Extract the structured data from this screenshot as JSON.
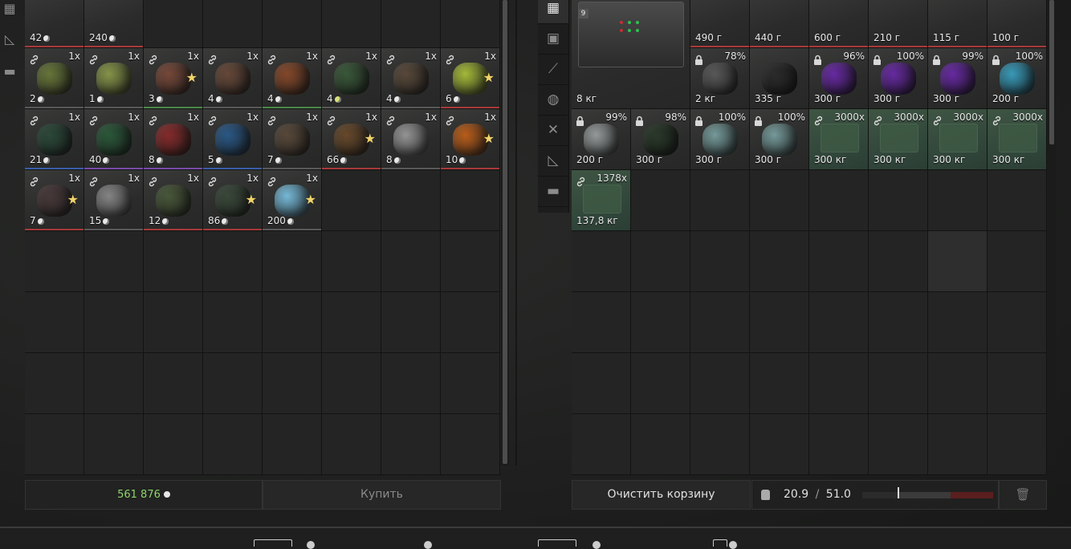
{
  "colors": {
    "accent_money": "#8fd46a",
    "rarity_red": "#a83a3a",
    "rarity_green": "#4a8a4a",
    "rarity_blue": "#3a5ea8",
    "rarity_purple": "#7a4aa8",
    "rarity_yellow": "#b8a03a",
    "rarity_grey": "#5a5a5a"
  },
  "left_sidebar": {
    "icons": [
      "grid-icon",
      "ruler-icon",
      "archive-icon"
    ]
  },
  "left_inventory": {
    "top_row": [
      {
        "val": "42",
        "rarity": "#a83a3a"
      },
      {
        "val": "240",
        "rarity": "#a83a3a"
      }
    ],
    "rows": [
      [
        {
          "qty": "1x",
          "val": "2",
          "color": "#6a7a3a",
          "rarity": "#5a5a5a"
        },
        {
          "qty": "1x",
          "val": "1",
          "color": "#8a9a4a",
          "rarity": "#5a5a5a"
        },
        {
          "qty": "1x",
          "val": "3",
          "color": "#7a4a3a",
          "rarity": "#4a8a4a",
          "star": "★"
        },
        {
          "qty": "1x",
          "val": "4",
          "color": "#6a4a3a",
          "rarity": "#5a5a5a"
        },
        {
          "qty": "1x",
          "val": "4",
          "color": "#8a4a2a",
          "rarity": "#4a8a4a"
        },
        {
          "qty": "1x",
          "val": "4",
          "color": "#3a5a3a",
          "rarity": "#5a5a5a",
          "coin_tint": "yellow"
        },
        {
          "qty": "1x",
          "val": "4",
          "color": "#5a4a3a",
          "rarity": "#5a5a5a"
        },
        {
          "qty": "1x",
          "val": "6",
          "color": "#aac03a",
          "rarity": "#a83a3a",
          "star": "★"
        }
      ],
      [
        {
          "qty": "1x",
          "val": "21",
          "color": "#2a4a3a",
          "rarity": "#3a5ea8"
        },
        {
          "qty": "1x",
          "val": "40",
          "color": "#2a5a3a",
          "rarity": "#7a4aa8"
        },
        {
          "qty": "1x",
          "val": "8",
          "color": "#8a2a2a",
          "rarity": "#7a4aa8"
        },
        {
          "qty": "1x",
          "val": "5",
          "color": "#2a5a8a",
          "rarity": "#3a5ea8"
        },
        {
          "qty": "1x",
          "val": "7",
          "color": "#5a4a3a",
          "rarity": "#5a5a5a"
        },
        {
          "qty": "1x",
          "val": "66",
          "color": "#6a4a2a",
          "rarity": "#a83a3a",
          "star": "★"
        },
        {
          "qty": "1x",
          "val": "8",
          "color": "#9a9a9a",
          "rarity": "#5a5a5a"
        },
        {
          "qty": "1x",
          "val": "10",
          "color": "#c0601a",
          "rarity": "#a83a3a",
          "star": "★"
        }
      ],
      [
        {
          "qty": "1x",
          "val": "7",
          "color": "#4a3a3a",
          "rarity": "#a83a3a",
          "star": "★"
        },
        {
          "qty": "1x",
          "val": "15",
          "color": "#8a8a8a",
          "rarity": "#5a5a5a"
        },
        {
          "qty": "1x",
          "val": "12",
          "color": "#4a5a3a",
          "rarity": "#a83a3a"
        },
        {
          "qty": "1x",
          "val": "86",
          "color": "#3a4a3a",
          "rarity": "#a83a3a",
          "star": "★"
        },
        {
          "qty": "1x",
          "val": "200",
          "color": "#7ac0e0",
          "rarity": "#5a5a5a",
          "star": "★"
        }
      ]
    ]
  },
  "right_sidebar": {
    "categories": [
      "grid-icon",
      "backpack-icon",
      "rifle-icon",
      "helmet-icon",
      "tools-icon",
      "ruler-icon",
      "archive-icon"
    ]
  },
  "right_inventory": {
    "top_row": [
      {
        "val": "490 г"
      },
      {
        "val": "440 г"
      },
      {
        "val": "600 г"
      },
      {
        "val": "210 г"
      },
      {
        "val": "115 г"
      },
      {
        "val": "100 г"
      }
    ],
    "big_item": {
      "val": "8 кг",
      "badge": "9",
      "color": "#3a3b3a"
    },
    "row1": [
      {
        "pct": "78%",
        "val": "2 кг",
        "color": "#5a5b5a"
      },
      {
        "val": "335 г",
        "color": "#2a2b2a"
      },
      {
        "pct": "96%",
        "val": "300 г",
        "color": "#6a2aa8"
      },
      {
        "pct": "100%",
        "val": "300 г",
        "color": "#6a2aa8"
      },
      {
        "pct": "99%",
        "val": "300 г",
        "color": "#6a2aa8"
      },
      {
        "pct": "100%",
        "val": "200 г",
        "color": "#3aa0c0"
      }
    ],
    "row2": [
      {
        "pct": "99%",
        "val": "200 г",
        "color": "#9aa0a0"
      },
      {
        "pct": "98%",
        "val": "300 г",
        "color": "#2a3a2a"
      },
      {
        "pct": "100%",
        "val": "300 г",
        "color": "#7aa0a0"
      },
      {
        "pct": "100%",
        "val": "300 г",
        "color": "#7aa0a0"
      },
      {
        "qty": "3000x",
        "val": "300 кг",
        "green": true
      },
      {
        "qty": "3000x",
        "val": "300 кг",
        "green": true
      },
      {
        "qty": "3000x",
        "val": "300 кг",
        "green": true
      },
      {
        "qty": "3000x",
        "val": "300 кг",
        "green": true
      }
    ],
    "row3": [
      {
        "qty": "1378x",
        "val": "137,8 кг",
        "green": true
      }
    ]
  },
  "money": {
    "amount": "561 876"
  },
  "buttons": {
    "buy": "Купить",
    "clear_cart": "Очистить корзину"
  },
  "weight": {
    "current": "20.9",
    "separator": "/",
    "max": "51.0",
    "fill_fraction": 0.41
  }
}
